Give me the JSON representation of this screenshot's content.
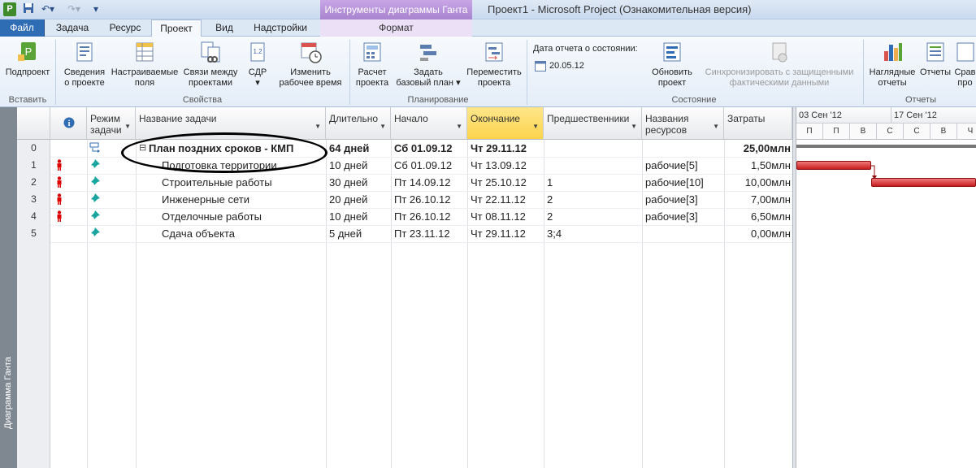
{
  "titlebar": {
    "app_icon": "P",
    "window_title": "Проект1 - Microsoft Project (Ознакомительная версия)",
    "context_group": "Инструменты диаграммы Ганта",
    "quick_access": {
      "save_icon": "save-icon",
      "undo_icon": "undo-icon",
      "redo_icon": "redo-icon",
      "customize_icon": "chevron-down-icon"
    }
  },
  "tabs": {
    "file": "Файл",
    "task": "Задача",
    "resource": "Ресурс",
    "project": "Проект",
    "view": "Вид",
    "addins": "Надстройки",
    "format": "Формат"
  },
  "ribbon": {
    "groups": {
      "insert": "Вставить",
      "properties": "Свойства",
      "schedule": "Планирование",
      "status": "Состояние",
      "reports": "Отчеты"
    },
    "buttons": {
      "subproject": "Подпроект",
      "project_info": [
        "Сведения",
        "о проекте"
      ],
      "custom_fields": [
        "Настраиваемые",
        "поля"
      ],
      "links_between": [
        "Связи между",
        "проектами"
      ],
      "wbs": "СДР",
      "change_worktime": [
        "Изменить",
        "рабочее время"
      ],
      "calculate": [
        "Расчет",
        "проекта"
      ],
      "set_baseline": [
        "Задать",
        "базовый план"
      ],
      "move_project": [
        "Переместить",
        "проекта"
      ],
      "update_project": [
        "Обновить",
        "проект"
      ],
      "sync_protected": [
        "Синхронизировать с защищенными",
        "фактическими данными"
      ],
      "visual_reports": [
        "Наглядные",
        "отчеты"
      ],
      "reports": "Отчеты",
      "compare": [
        "Срав",
        "про"
      ]
    },
    "status_date": {
      "label": "Дата отчета о состоянии:",
      "value": "20.05.12"
    }
  },
  "viewbar": {
    "label": "Диаграмма Ганта"
  },
  "columns": {
    "mode": [
      "Режим",
      "задачи"
    ],
    "name": "Название задачи",
    "duration": "Длительно",
    "start": "Начало",
    "finish": "Окончание",
    "predecessors": "Предшественники",
    "resources": [
      "Названия",
      "ресурсов"
    ],
    "cost": "Затраты"
  },
  "tasks": [
    {
      "id": "0",
      "name": "План поздних сроков - КМП",
      "duration": "64 дней",
      "start": "Сб 01.09.12",
      "finish": "Чт 29.11.12",
      "pred": "",
      "res": "",
      "cost": "25,00млн"
    },
    {
      "id": "1",
      "name": "Подготовка территории",
      "duration": "10 дней",
      "start": "Сб 01.09.12",
      "finish": "Чт 13.09.12",
      "pred": "",
      "res": "рабочие[5]",
      "cost": "1,50млн"
    },
    {
      "id": "2",
      "name": "Строительные работы",
      "duration": "30 дней",
      "start": "Пт 14.09.12",
      "finish": "Чт 25.10.12",
      "pred": "1",
      "res": "рабочие[10]",
      "cost": "10,00млн"
    },
    {
      "id": "3",
      "name": "Инженерные сети",
      "duration": "20 дней",
      "start": "Пт 26.10.12",
      "finish": "Чт 22.11.12",
      "pred": "2",
      "res": "рабочие[3]",
      "cost": "7,00млн"
    },
    {
      "id": "4",
      "name": "Отделочные работы",
      "duration": "10 дней",
      "start": "Пт 26.10.12",
      "finish": "Чт 08.11.12",
      "pred": "2",
      "res": "рабочие[3]",
      "cost": "6,50млн"
    },
    {
      "id": "5",
      "name": "Сдача объекта",
      "duration": "5 дней",
      "start": "Пт 23.11.12",
      "finish": "Чт 29.11.12",
      "pred": "3;4",
      "res": "",
      "cost": "0,00млн"
    }
  ],
  "gantt": {
    "weeks": [
      "03 Сен '12",
      "17 Сен '12"
    ],
    "days": [
      "П",
      "П",
      "В",
      "С",
      "С",
      "В",
      "Ч"
    ]
  },
  "colors": {
    "accent": "#2e6db4",
    "context": "#a883cf",
    "selected_header": "#fbd44c",
    "gantt_bar": "#c81d1d"
  }
}
